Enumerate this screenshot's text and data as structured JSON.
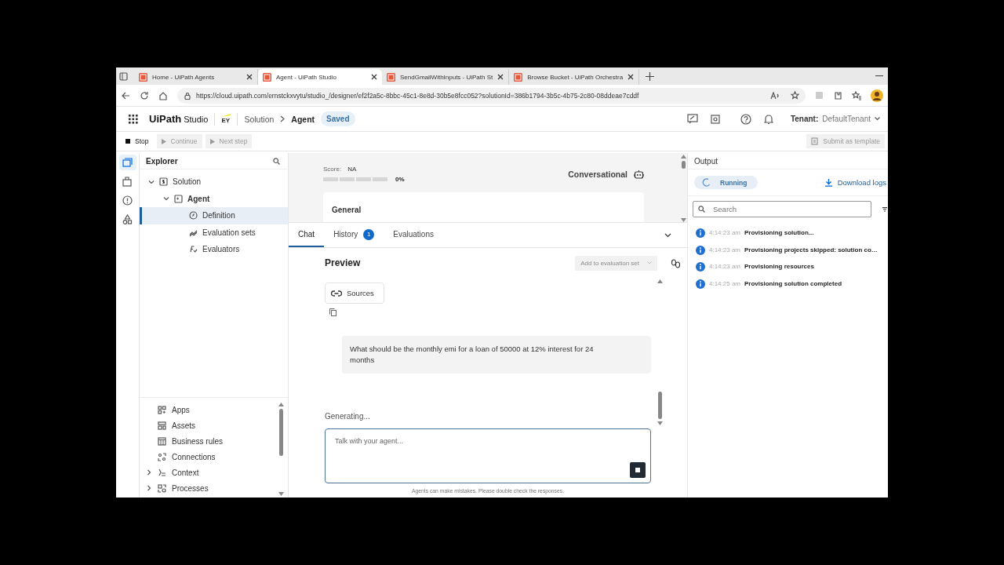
{
  "browser": {
    "tabs": [
      {
        "title": "Home - UiPath Agents",
        "selected": false
      },
      {
        "title": "Agent - UiPath Studio",
        "selected": true
      },
      {
        "title": "SendGmailWithInputs - UiPath St",
        "selected": false
      },
      {
        "title": "Browse Bucket - UiPath Orchestra",
        "selected": false
      }
    ],
    "url": "https://cloud.uipath.com/ernstckxvytu/studio_/designer/ef2f2a5c-8bbc-45c1-8e8d-30b5e8fcc052?solutionId=386b1794-3b5c-4b75-2c80-08ddeae7cddf"
  },
  "header": {
    "brand": "UiPath",
    "product": "Studio",
    "partner": "EY",
    "breadcrumb": [
      "Solution",
      "Agent"
    ],
    "status": "Saved",
    "tenant_label": "Tenant:",
    "tenant": "DefaultTenant"
  },
  "toolbar": {
    "buttons": [
      {
        "label": "Stop",
        "kind": "stop",
        "disabled": false
      },
      {
        "label": "Continue",
        "kind": "play",
        "disabled": true
      },
      {
        "label": "Next step",
        "kind": "play",
        "disabled": true
      }
    ],
    "submit": {
      "label": "Submit as template",
      "disabled": true
    }
  },
  "activity_bar": [
    {
      "kind": "explorer",
      "selected": true
    },
    {
      "kind": "package",
      "selected": false
    },
    {
      "kind": "alert",
      "selected": false
    },
    {
      "kind": "shapes",
      "selected": false
    }
  ],
  "explorer": {
    "title": "Explorer",
    "tree": [
      {
        "label": "Solution",
        "kind": "solution",
        "expanded": true,
        "selected": false,
        "children": [
          {
            "label": "Agent",
            "kind": "agent",
            "expanded": true,
            "selected": false,
            "children": [
              {
                "label": "Definition",
                "kind": "definition",
                "selected": true
              },
              {
                "label": "Evaluation sets",
                "kind": "evalsets",
                "selected": false
              },
              {
                "label": "Evaluators",
                "kind": "evaluators",
                "selected": false
              }
            ]
          }
        ]
      }
    ],
    "resources": [
      {
        "label": "Apps",
        "kind": "apps"
      },
      {
        "label": "Assets",
        "kind": "assets"
      },
      {
        "label": "Business rules",
        "kind": "table"
      },
      {
        "label": "Connections",
        "kind": "connections"
      },
      {
        "label": "Context",
        "kind": "context",
        "expanded": false
      },
      {
        "label": "Processes",
        "kind": "processes",
        "expanded": false
      }
    ]
  },
  "definition": {
    "score_label": "Score:",
    "score": "NA",
    "progress": {
      "level": 0,
      "reading": "0%"
    },
    "agent_type": "Conversational",
    "section": "General"
  },
  "chat": {
    "tabs": [
      {
        "label": "Chat",
        "selected": true
      },
      {
        "label": "History",
        "badge": "1",
        "selected": false
      },
      {
        "label": "Evaluations",
        "selected": false
      }
    ],
    "title": "Preview",
    "add_to_set": {
      "label": "Add to evaluation set",
      "disabled": true
    },
    "sources": "Sources",
    "user_message": "What should be the monthly emi for a loan of 50000 at 12% interest for 24 months",
    "generating": "Generating...",
    "input": {
      "placeholder": "Talk with your agent..."
    },
    "disclaimer": "Agents can make mistakes. Please double check the responses."
  },
  "output": {
    "title": "Output",
    "status": "Running",
    "download": "Download logs",
    "search": {
      "placeholder": "Search"
    },
    "logs": [
      {
        "time": "4:14:23 am",
        "message": "Provisioning solution..."
      },
      {
        "time": "4:14:23 am",
        "message": "Provisioning projects skipped: solution co…"
      },
      {
        "time": "4:14:23 am",
        "message": "Provisioning resources"
      },
      {
        "time": "4:14:25 am",
        "message": "Provisioning solution completed"
      }
    ]
  }
}
